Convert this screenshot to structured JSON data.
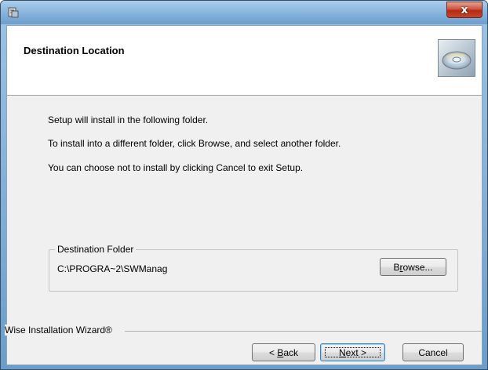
{
  "window": {
    "close_label": "x"
  },
  "header": {
    "title": "Destination Location"
  },
  "body": {
    "line1": "Setup will install  in the following folder.",
    "line2": "To install into a different folder, click Browse, and select another folder.",
    "line3": "You can choose not to install  by clicking Cancel to exit Setup."
  },
  "destination": {
    "group_label": "Destination Folder",
    "path": "C:\\PROGRA~2\\SWManag",
    "browse_pre": "B",
    "browse_underline": "r",
    "browse_post": "owse..."
  },
  "footer": {
    "brand": "Wise Installation Wizard®",
    "back_pre": "< ",
    "back_underline": "B",
    "back_post": "ack",
    "next_underline": "N",
    "next_post": "ext >",
    "cancel_label": "Cancel"
  }
}
